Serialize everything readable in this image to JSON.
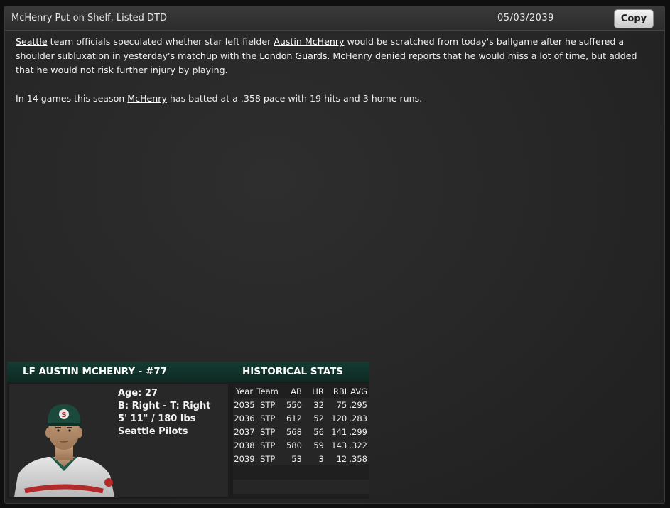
{
  "header": {
    "title": "McHenry Put on Shelf, Listed DTD",
    "date": "05/03/2039",
    "copy_label": "Copy"
  },
  "article": {
    "p1": {
      "team": "Seattle",
      "t1": " team officials speculated whether star left fielder ",
      "player": "Austin McHenry",
      "t2": " would be scratched from today's ballgame after he suffered a shoulder subluxation in yesterday's matchup with the ",
      "opponent": "London Guards.",
      "t3": " McHenry denied reports that he would miss a lot of time, but added that he would not risk further injury by playing."
    },
    "p2": {
      "t1": "In 14 games this season ",
      "player": "McHenry",
      "t2": " has batted at a .358 pace with 19 hits and 3 home runs."
    }
  },
  "card": {
    "player_heading": "LF AUSTIN MCHENRY - #77",
    "stats_heading": "HISTORICAL STATS",
    "bio": {
      "age": "Age: 27",
      "bats_throws": "B: Right - T: Right",
      "size": "5' 11\" / 180 lbs",
      "team": "Seattle Pilots"
    },
    "stats": {
      "columns": [
        "Year",
        "Team",
        "AB",
        "HR",
        "RBI",
        "AVG"
      ],
      "rows": [
        [
          "2035",
          "STP",
          "550",
          "32",
          "75",
          ".295"
        ],
        [
          "2036",
          "STP",
          "612",
          "52",
          "120",
          ".283"
        ],
        [
          "2037",
          "STP",
          "568",
          "56",
          "141",
          ".299"
        ],
        [
          "2038",
          "STP",
          "580",
          "59",
          "143",
          ".322"
        ],
        [
          "2039",
          "STP",
          "53",
          "3",
          "12",
          ".358"
        ]
      ]
    }
  },
  "icons": {
    "portrait": "player-portrait-icon"
  },
  "colors": {
    "card_header": "#143c32",
    "panel_bg": "#262626",
    "text": "#f0f0f0"
  }
}
